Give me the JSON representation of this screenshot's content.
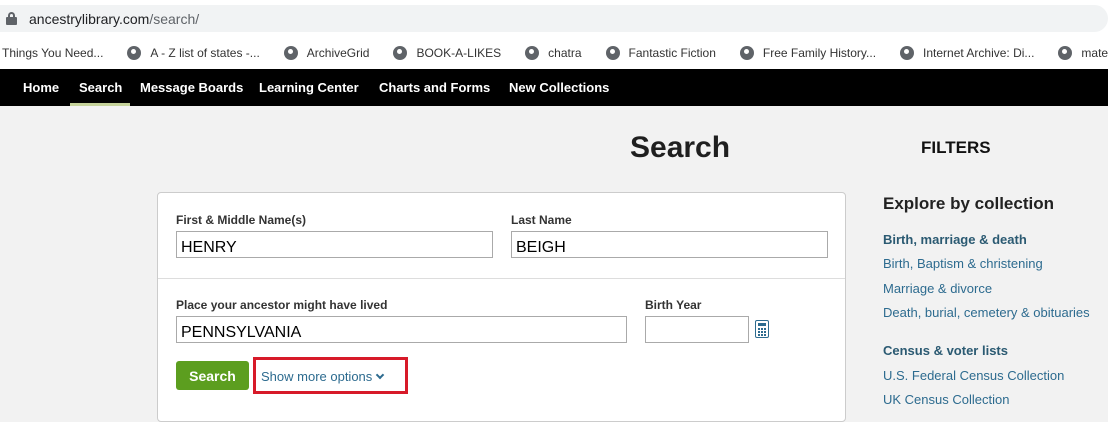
{
  "browser": {
    "url_host": "ancestrylibrary.com",
    "url_path": "/search/",
    "bookmarks": [
      {
        "label": "Things You Need...",
        "icon": "none"
      },
      {
        "label": "A - Z list of states -...",
        "icon": "globe-icon"
      },
      {
        "label": "ArchiveGrid",
        "icon": "globe-icon"
      },
      {
        "label": "BOOK-A-LIKES",
        "icon": "globe-icon"
      },
      {
        "label": "chatra",
        "icon": "globe-icon"
      },
      {
        "label": "Fantastic Fiction",
        "icon": "globe-icon"
      },
      {
        "label": "Free Family History...",
        "icon": "globe-icon"
      },
      {
        "label": "Internet Archive: Di...",
        "icon": "globe-icon"
      },
      {
        "label": "materials request U",
        "icon": "globe-icon"
      }
    ]
  },
  "nav": {
    "items": [
      {
        "label": "Home"
      },
      {
        "label": "Search",
        "active": true
      },
      {
        "label": "Message Boards"
      },
      {
        "label": "Learning Center"
      },
      {
        "label": "Charts and Forms"
      },
      {
        "label": "New Collections"
      }
    ]
  },
  "page": {
    "title": "Search"
  },
  "form": {
    "first_name_label": "First & Middle Name(s)",
    "first_name_value": "HENRY",
    "last_name_label": "Last Name",
    "last_name_value": "BEIGH",
    "place_label": "Place your ancestor might have lived",
    "place_value": "PENNSYLVANIA",
    "birth_year_label": "Birth Year",
    "birth_year_value": "",
    "search_button": "Search",
    "more_options": "Show more options",
    "highlight_color": "#d71a29",
    "button_color": "#5c9e1f"
  },
  "filters": {
    "title": "FILTERS",
    "explore_title": "Explore by collection",
    "links": [
      {
        "label": "Birth, marriage & death",
        "heading": true
      },
      {
        "label": "Birth, Baptism & christening"
      },
      {
        "label": "Marriage & divorce"
      },
      {
        "label": "Death, burial, cemetery & obituaries"
      },
      {
        "label": "Census & voter lists",
        "heading": true
      },
      {
        "label": "U.S. Federal Census Collection"
      },
      {
        "label": "UK Census Collection"
      }
    ],
    "link_color": "#2d6b8f"
  }
}
